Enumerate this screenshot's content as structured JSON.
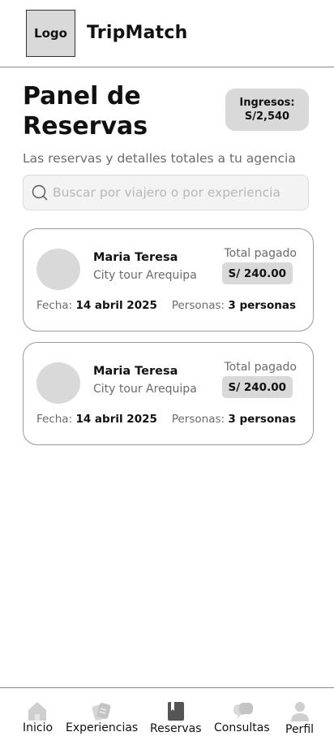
{
  "header": {
    "logo_label": "Logo",
    "app_title": "TripMatch"
  },
  "page": {
    "title_line1": "Panel de",
    "title_line2": "Reservas",
    "income_label": "Ingresos:",
    "income_value": "S/2,540",
    "subtitle": "Las reservas y detalles totales a tu agencia"
  },
  "search": {
    "placeholder": "Buscar por viajero o por experiencia",
    "value": ""
  },
  "reservations": [
    {
      "name": "Maria Teresa",
      "tour": "City tour Arequipa",
      "paid_label": "Total pagado",
      "amount": "S/ 240.00",
      "date_label": "Fecha:",
      "date_value": "14 abril 2025",
      "people_label": "Personas:",
      "people_value": "3 personas"
    },
    {
      "name": "Maria Teresa",
      "tour": "City tour Arequipa",
      "paid_label": "Total pagado",
      "amount": "S/ 240.00",
      "date_label": "Fecha:",
      "date_value": "14 abril 2025",
      "people_label": "Personas:",
      "people_value": "3 personas"
    }
  ],
  "bottom_nav": {
    "items": [
      {
        "label": "Inicio",
        "icon": "home-icon",
        "active": false
      },
      {
        "label": "Experiencias",
        "icon": "experiences-icon",
        "active": false
      },
      {
        "label": "Reservas",
        "icon": "book-icon",
        "active": true
      },
      {
        "label": "Consultas",
        "icon": "chat-icon",
        "active": false
      },
      {
        "label": "Perfil",
        "icon": "user-icon",
        "active": false
      }
    ]
  },
  "colors": {
    "placeholder_gray": "#d9d9d9",
    "muted_text": "#6b6b6b",
    "nav_icon_inactive": "#cfcfcf",
    "nav_icon_active": "#555555"
  }
}
